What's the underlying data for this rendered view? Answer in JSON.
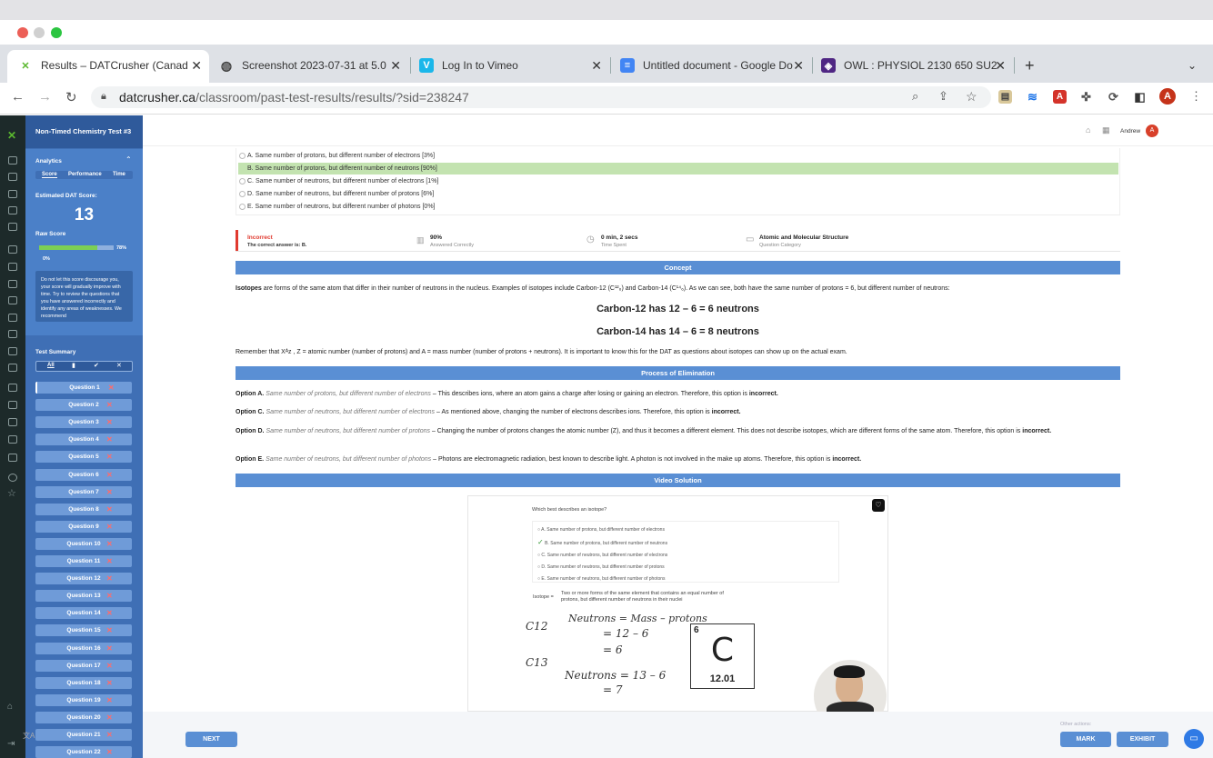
{
  "browser": {
    "tabs": [
      {
        "label": "Results – DATCrusher (Canad",
        "icon": "datcrusher-icon",
        "active": true
      },
      {
        "label": "Screenshot 2023-07-31 at 5.0",
        "icon": "globe-icon"
      },
      {
        "label": "Log In to Vimeo",
        "icon": "vimeo-icon"
      },
      {
        "label": "Untitled document - Google Do",
        "icon": "google-docs-icon"
      },
      {
        "label": "OWL : PHYSIOL 2130 650 SU2",
        "icon": "owl-icon"
      }
    ],
    "url_domain": "datcrusher.ca",
    "url_path": "/classroom/past-test-results/results/?sid=238247",
    "profile_initial": "A"
  },
  "sidebar": {
    "test_title": "Non-Timed Chemistry Test #3",
    "analytics_label": "Analytics",
    "analytics_tabs": [
      "Score",
      "Performance",
      "Time"
    ],
    "estimated_label": "Estimated DAT Score:",
    "estimated_score": "13",
    "raw_label": "Raw Score",
    "raw_percent": "78%",
    "raw_fill": 0.78,
    "raw_zero": "0%",
    "message": "Do not let this score discourage you, your score will gradually improve with time. Try to review the questions that you have answered incorrectly and identify any areas of weaknesses. We recommend",
    "summary_label": "Test Summary",
    "filters": [
      "All",
      "bookmark",
      "check",
      "x"
    ],
    "questions": [
      "Question 1",
      "Question 2",
      "Question 3",
      "Question 4",
      "Question 5",
      "Question 6",
      "Question 7",
      "Question 8",
      "Question 9",
      "Question 10",
      "Question 11",
      "Question 12",
      "Question 13",
      "Question 14",
      "Question 15",
      "Question 16",
      "Question 17",
      "Question 18",
      "Question 19",
      "Question 20",
      "Question 21",
      "Question 22"
    ]
  },
  "topbar": {
    "user_name": "Andrew",
    "user_initial": "A"
  },
  "answers": [
    "A. Same number of protons, but different number of electrons [3%]",
    "B. Same number of protons, but different number of neutrons [90%]",
    "C. Same number of neutrons, but different number of electrons [1%]",
    "D. Same number of neutrons, but different number of protons [6%]",
    "E. Same number of neutrons, but different number of photons [0%]"
  ],
  "stats": {
    "status": "Incorrect",
    "correct_answer": "The correct answer is: B.",
    "percent": "90%",
    "percent_label": "Answered Correctly",
    "time": "0 min, 2 secs",
    "time_label": "Time Spent",
    "category": "Atomic and Molecular Structure",
    "category_label": "Question Category"
  },
  "concept": {
    "header": "Concept",
    "p1_bold": "Isotopes",
    "p1": " are forms of the same atom that differ in their number of neutrons in the nucleus. Examples of isotopes include Carbon-12 (C¹²₆) and Carbon-14 (C¹⁴₆). As we can see, both have the same number of protons = 6, but different number of neutrons:",
    "line1": "Carbon-12 has 12 – 6 = 6 neutrons",
    "line2": "Carbon-14 has 14 – 6 = 8 neutrons",
    "p2": "Remember that Xᴬz , Z = atomic number (number of protons) and A = mass number (number of protons + neutrons). It is important to know this for the DAT as questions about isotopes can show up on the actual exam."
  },
  "elimination": {
    "header": "Process of Elimination",
    "options": [
      {
        "label": "Option A.",
        "quote": "Same number of protons, but different number of electrons",
        "text": " – This describes ions, where an atom gains a charge after losing or gaining an electron. Therefore, this option is ",
        "verdict": "incorrect."
      },
      {
        "label": "Option C.",
        "quote": "Same number of neutrons, but different number of electrons",
        "text": " – As mentioned above, changing the number of electrons describes ions. Therefore, this option is ",
        "verdict": "incorrect."
      },
      {
        "label": "Option D.",
        "quote": "Same number of neutrons, but different number of protons",
        "text": " – Changing the number of protons changes the atomic number (Z), and thus it becomes a different element. This does not describe isotopes, which are different forms of the same atom. Therefore, this option is ",
        "verdict": "incorrect."
      },
      {
        "label": "Option E.",
        "quote": "Same number of neutrons, but different number of photons",
        "text": " – Photons are electromagnetic radiation, best known to describe light. A photon is not involved in the make up atoms. Therefore, this option is ",
        "verdict": "incorrect."
      }
    ]
  },
  "video": {
    "header": "Video Solution",
    "question": "Which best describes an isotope?",
    "options": [
      "A. Same number of protons, but different number of electrons",
      "B. Same number of protons, but different number of neutrons",
      "C. Same number of neutrons, but different number of electrons",
      "D. Same number of neutrons, but different number of protons",
      "E. Same number of neutrons, but different number of photons"
    ],
    "isotope_term": "Isotope =",
    "isotope_def": "Two or more forms of the same element that contains an equal number of protons, but different number of neutrons in their nuclei",
    "hw_c12": "C12",
    "hw_c13": "C13",
    "hw_eq1": "Neutrons = Mass – protons",
    "hw_eq1b": "= 12 – 6",
    "hw_eq1c": "= 6",
    "hw_eq2": "Neutrons = 13 – 6",
    "hw_eq2b": "= 7",
    "tile_number": "6",
    "tile_symbol": "C",
    "tile_mass": "12.01"
  },
  "footer": {
    "next": "NEXT",
    "other_actions": "Other actions:",
    "mark": "MARK",
    "exhibit": "EXHIBIT"
  }
}
